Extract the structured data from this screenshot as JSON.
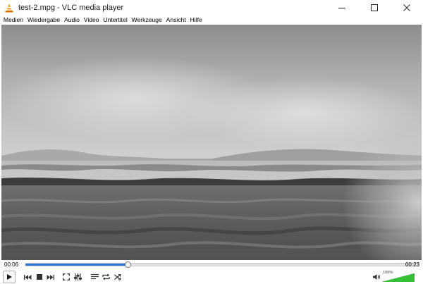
{
  "window": {
    "title": "test-2.mpg - VLC media player"
  },
  "menu": [
    "Medien",
    "Wiedergabe",
    "Audio",
    "Video",
    "Untertitel",
    "Werkzeuge",
    "Ansicht",
    "Hilfe"
  ],
  "playback": {
    "elapsed": "00:06",
    "total": "00:23",
    "progress": 0.26
  },
  "volume": {
    "label": "100%",
    "level": 1.0
  },
  "icons": {
    "app": "vlc-cone-icon",
    "minimize": "minimize-icon",
    "maximize": "maximize-icon",
    "close": "close-icon",
    "play": "play-icon",
    "previous": "skip-previous-icon",
    "stop": "stop-icon",
    "next": "skip-next-icon",
    "fullscreen": "fullscreen-icon",
    "extended": "equalizer-icon",
    "playlist": "playlist-icon",
    "loop": "loop-icon",
    "random": "shuffle-icon",
    "volume": "speaker-icon"
  },
  "colors": {
    "accent": "#2a78d6",
    "vlc_orange": "#f08a00",
    "volume_green": "#35c135"
  }
}
